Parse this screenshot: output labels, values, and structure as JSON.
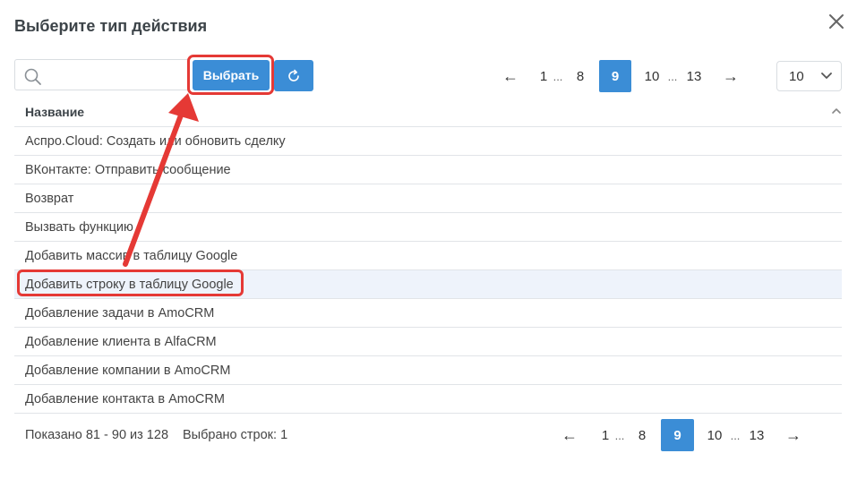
{
  "dialog": {
    "title": "Выберите тип действия"
  },
  "toolbar": {
    "search_value": "",
    "search_placeholder": "",
    "select_label": "Выбрать"
  },
  "pagination_top": {
    "prev": "←",
    "first": "1",
    "ellipsis_1": "...",
    "page_prev": "8",
    "current": "9",
    "page_next": "10",
    "ellipsis_2": "...",
    "last": "13",
    "next": "→"
  },
  "per_page": {
    "selected": "10"
  },
  "table": {
    "header": "Название",
    "rows": [
      "Аспро.Cloud: Создать или обновить сделку",
      "ВКонтакте: Отправить сообщение",
      "Возврат",
      "Вызвать функцию",
      "Добавить массив в таблицу Google",
      "Добавить строку в таблицу Google",
      "Добавление задачи в AmoCRM",
      "Добавление клиента в AlfaCRM",
      "Добавление компании в AmoCRM",
      "Добавление контакта в AmoCRM"
    ],
    "selected_index": 5
  },
  "footer": {
    "shown": "Показано 81 - 90 из 128",
    "selected_rows": "Выбрано строк: 1"
  },
  "pagination_bottom": {
    "prev": "←",
    "first": "1",
    "ellipsis_1": "...",
    "page_prev": "8",
    "current": "9",
    "page_next": "10",
    "ellipsis_2": "...",
    "last": "13",
    "next": "→"
  },
  "colors": {
    "accent": "#3b8dd6",
    "highlight": "#e53935",
    "selected_row": "#eef3fb"
  }
}
